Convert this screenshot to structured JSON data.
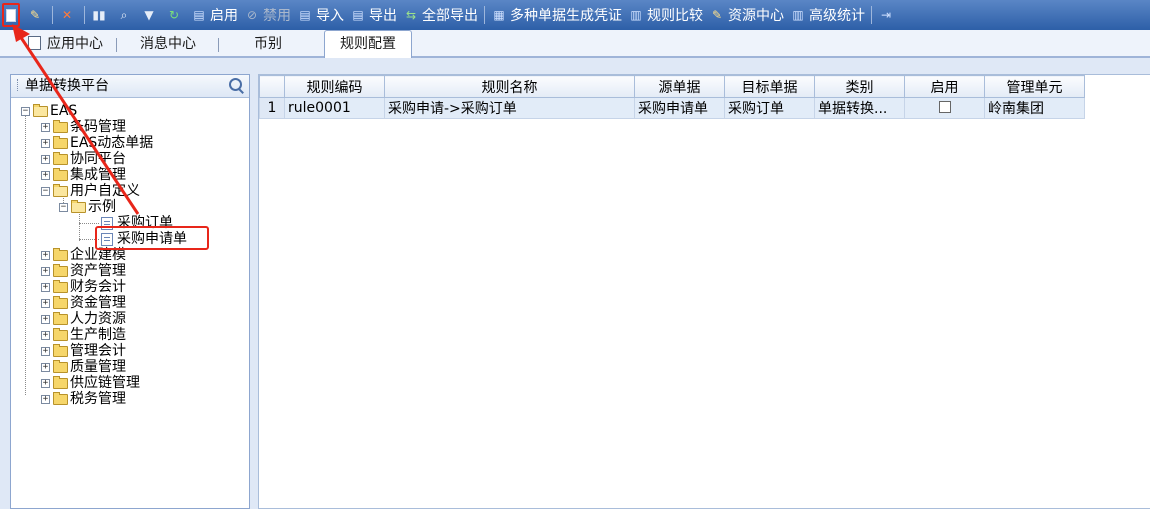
{
  "toolbar": {
    "items": [
      {
        "name": "new-button",
        "label": "",
        "icon": "new-document-icon"
      },
      {
        "name": "edit-button",
        "label": "",
        "icon": "broom-icon"
      },
      {
        "name": "delete-button",
        "label": "",
        "icon": "delete-x-icon"
      },
      {
        "name": "save-button",
        "label": "",
        "icon": "save-icon"
      },
      {
        "name": "search-button",
        "label": "",
        "icon": "find-icon"
      },
      {
        "name": "filter-button",
        "label": "",
        "icon": "dropdown-triangle-icon"
      },
      {
        "name": "refresh-button",
        "label": "",
        "icon": "refresh-icon"
      },
      {
        "name": "enable-button",
        "label": "启用",
        "icon": "enable-icon"
      },
      {
        "name": "disable-button",
        "label": "禁用",
        "icon": "disable-icon",
        "disabled": true
      },
      {
        "name": "import-button",
        "label": "导入",
        "icon": "import-icon"
      },
      {
        "name": "export-button",
        "label": "导出",
        "icon": "export-icon"
      },
      {
        "name": "export-all-button",
        "label": "全部导出",
        "icon": "export-all-icon"
      },
      {
        "name": "multi-voucher-button",
        "label": "多种单据生成凭证",
        "icon": "voucher-icon"
      },
      {
        "name": "rule-compare-button",
        "label": "规则比较",
        "icon": "compare-icon"
      },
      {
        "name": "resource-center-button",
        "label": "资源中心",
        "icon": "resource-icon"
      },
      {
        "name": "advanced-stats-button",
        "label": "高级统计",
        "icon": "stats-icon"
      },
      {
        "name": "exit-button",
        "label": "",
        "icon": "exit-icon"
      }
    ]
  },
  "tabs": [
    {
      "name": "tab-app-center",
      "label": "应用中心"
    },
    {
      "name": "tab-message-center",
      "label": "消息中心"
    },
    {
      "name": "tab-currency",
      "label": "币别"
    },
    {
      "name": "tab-rule-config",
      "label": "规则配置",
      "active": true
    }
  ],
  "left_panel": {
    "title": "单据转换平台",
    "tree": [
      {
        "label": "EAS",
        "level": 0,
        "expanded": true
      },
      {
        "label": "条码管理",
        "level": 1
      },
      {
        "label": "EAS动态单据",
        "level": 1
      },
      {
        "label": "协同平台",
        "level": 1
      },
      {
        "label": "集成管理",
        "level": 1
      },
      {
        "label": "用户自定义",
        "level": 1,
        "expanded": true
      },
      {
        "label": "示例",
        "level": 2,
        "expanded": true
      },
      {
        "label": "采购订单",
        "level": 3,
        "leaf": true
      },
      {
        "label": "采购申请单",
        "level": 3,
        "leaf": true,
        "selected": true
      },
      {
        "label": "企业建模",
        "level": 1
      },
      {
        "label": "资产管理",
        "level": 1
      },
      {
        "label": "财务会计",
        "level": 1
      },
      {
        "label": "资金管理",
        "level": 1
      },
      {
        "label": "人力资源",
        "level": 1
      },
      {
        "label": "生产制造",
        "level": 1
      },
      {
        "label": "管理会计",
        "level": 1
      },
      {
        "label": "质量管理",
        "level": 1
      },
      {
        "label": "供应链管理",
        "level": 1
      },
      {
        "label": "税务管理",
        "level": 1
      }
    ]
  },
  "grid": {
    "columns": [
      "规则编码",
      "规则名称",
      "源单据",
      "目标单据",
      "类别",
      "启用",
      "管理单元"
    ],
    "rows": [
      {
        "rownum": "1",
        "cells": [
          "rule0001",
          "采购申请->采购订单",
          "采购申请单",
          "采购订单",
          "单据转换...",
          "",
          "岭南集团"
        ],
        "enabled": false
      }
    ]
  },
  "colors": {
    "toolbar_top": "#5a86c6",
    "toolbar_bottom": "#2d5fa8",
    "annotation_red": "#e8261a"
  }
}
